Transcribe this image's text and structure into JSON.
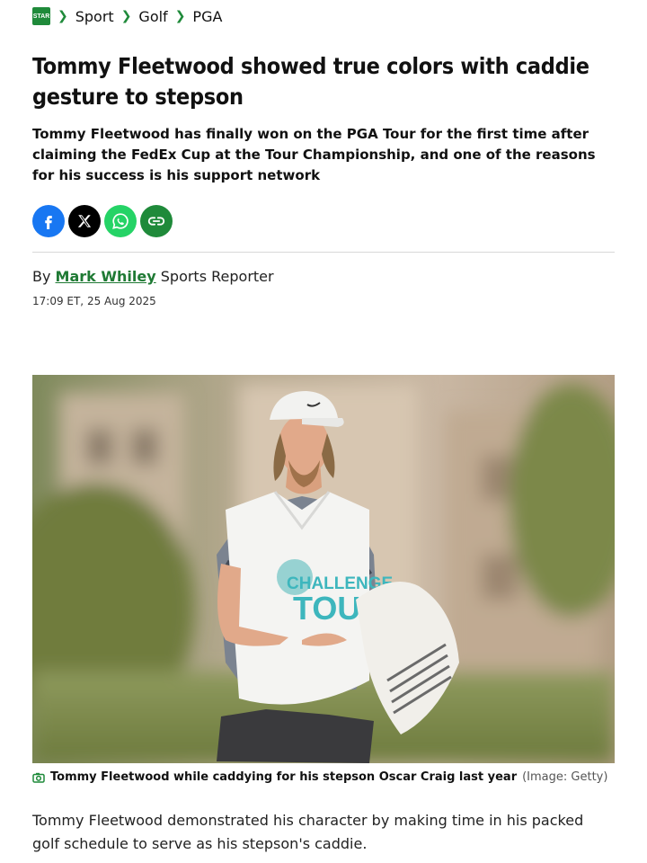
{
  "breadcrumb": {
    "logo_text": "STAR",
    "items": [
      "Sport",
      "Golf",
      "PGA"
    ]
  },
  "article": {
    "headline": "Tommy Fleetwood showed true colors with caddie gesture to stepson",
    "standfirst": "Tommy Fleetwood has finally won on the PGA Tour for the first time after claiming the FedEx Cup at the Tour Championship, and one of the reasons for his success is his support network",
    "byline_prefix": "By",
    "author": "Mark Whiley",
    "author_role": "Sports Reporter",
    "timestamp": "17:09 ET, 25 Aug 2025",
    "image_bib_text_1": "CHALLENGE",
    "image_bib_text_2": "TOUR",
    "caption": "Tommy Fleetwood while caddying for his stepson Oscar Craig last year",
    "credit": "(Image: Getty)",
    "body": "Tommy Fleetwood demonstrated his character by making time in his packed golf schedule to serve as his stepson's caddie."
  },
  "share": [
    "facebook-icon",
    "x-icon",
    "whatsapp-icon",
    "link-icon"
  ],
  "colors": {
    "brand_green": "#1f8a3a",
    "facebook": "#1877f2",
    "whatsapp": "#25d366"
  }
}
